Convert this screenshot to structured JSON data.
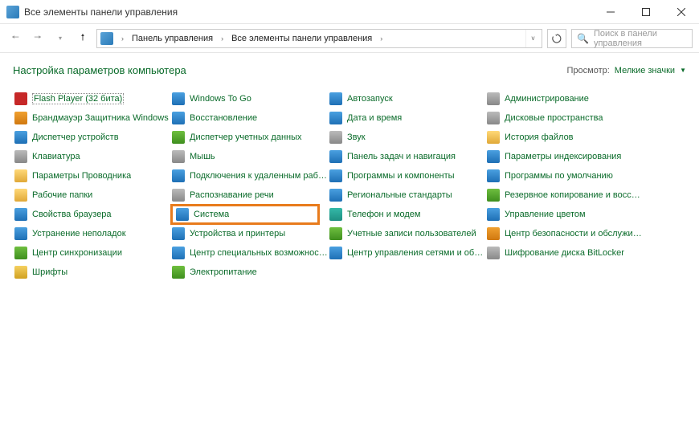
{
  "window": {
    "title": "Все элементы панели управления"
  },
  "breadcrumb": {
    "seg1": "Панель управления",
    "seg2": "Все элементы панели управления"
  },
  "search": {
    "placeholder": "Поиск в панели управления"
  },
  "heading": "Настройка параметров компьютера",
  "view": {
    "label": "Просмотр:",
    "value": "Мелкие значки"
  },
  "items": [
    {
      "label": "Flash Player (32 бита)",
      "icon": "ic-red",
      "name": "item-flash-player"
    },
    {
      "label": "Windows To Go",
      "icon": "ic-blue",
      "name": "item-windows-to-go"
    },
    {
      "label": "Автозапуск",
      "icon": "ic-blue",
      "name": "item-autoplay"
    },
    {
      "label": "Администрирование",
      "icon": "ic-gray",
      "name": "item-admin-tools"
    },
    {
      "label": "Брандмауэр Защитника Windows",
      "icon": "ic-orange",
      "name": "item-firewall"
    },
    {
      "label": "Восстановление",
      "icon": "ic-blue",
      "name": "item-recovery"
    },
    {
      "label": "Дата и время",
      "icon": "ic-blue",
      "name": "item-date-time"
    },
    {
      "label": "Дисковые пространства",
      "icon": "ic-gray",
      "name": "item-storage-spaces"
    },
    {
      "label": "Диспетчер устройств",
      "icon": "ic-blue",
      "name": "item-device-manager"
    },
    {
      "label": "Диспетчер учетных данных",
      "icon": "ic-green",
      "name": "item-credential-manager"
    },
    {
      "label": "Звук",
      "icon": "ic-gray",
      "name": "item-sound"
    },
    {
      "label": "История файлов",
      "icon": "ic-folder",
      "name": "item-file-history"
    },
    {
      "label": "Клавиатура",
      "icon": "ic-gray",
      "name": "item-keyboard"
    },
    {
      "label": "Мышь",
      "icon": "ic-gray",
      "name": "item-mouse"
    },
    {
      "label": "Панель задач и навигация",
      "icon": "ic-blue",
      "name": "item-taskbar"
    },
    {
      "label": "Параметры индексирования",
      "icon": "ic-blue",
      "name": "item-indexing"
    },
    {
      "label": "Параметры Проводника",
      "icon": "ic-folder",
      "name": "item-explorer-options"
    },
    {
      "label": "Подключения к удаленным рабоч...",
      "icon": "ic-blue",
      "name": "item-remote-app"
    },
    {
      "label": "Программы и компоненты",
      "icon": "ic-blue",
      "name": "item-programs-features"
    },
    {
      "label": "Программы по умолчанию",
      "icon": "ic-blue",
      "name": "item-default-programs"
    },
    {
      "label": "Рабочие папки",
      "icon": "ic-folder",
      "name": "item-work-folders"
    },
    {
      "label": "Распознавание речи",
      "icon": "ic-gray",
      "name": "item-speech"
    },
    {
      "label": "Региональные стандарты",
      "icon": "ic-blue",
      "name": "item-region"
    },
    {
      "label": "Резервное копирование и восстан...",
      "icon": "ic-green",
      "name": "item-backup"
    },
    {
      "label": "Свойства браузера",
      "icon": "ic-blue",
      "name": "item-internet-options"
    },
    {
      "label": "Система",
      "icon": "ic-blue",
      "name": "item-system",
      "highlight": true
    },
    {
      "label": "Телефон и модем",
      "icon": "ic-teal",
      "name": "item-phone-modem"
    },
    {
      "label": "Управление цветом",
      "icon": "ic-blue",
      "name": "item-color-management"
    },
    {
      "label": "Устранение неполадок",
      "icon": "ic-blue",
      "name": "item-troubleshooting"
    },
    {
      "label": "Устройства и принтеры",
      "icon": "ic-blue",
      "name": "item-devices-printers"
    },
    {
      "label": "Учетные записи пользователей",
      "icon": "ic-green",
      "name": "item-user-accounts"
    },
    {
      "label": "Центр безопасности и обслужив...",
      "icon": "ic-orange",
      "name": "item-security-maintenance"
    },
    {
      "label": "Центр синхронизации",
      "icon": "ic-green",
      "name": "item-sync-center"
    },
    {
      "label": "Центр специальных возможностей",
      "icon": "ic-blue",
      "name": "item-ease-of-access"
    },
    {
      "label": "Центр управления сетями и общи...",
      "icon": "ic-blue",
      "name": "item-network-sharing"
    },
    {
      "label": "Шифрование диска BitLocker",
      "icon": "ic-gray",
      "name": "item-bitlocker"
    },
    {
      "label": "Шрифты",
      "icon": "ic-yellow",
      "name": "item-fonts"
    },
    {
      "label": "Электропитание",
      "icon": "ic-green",
      "name": "item-power-options"
    }
  ]
}
